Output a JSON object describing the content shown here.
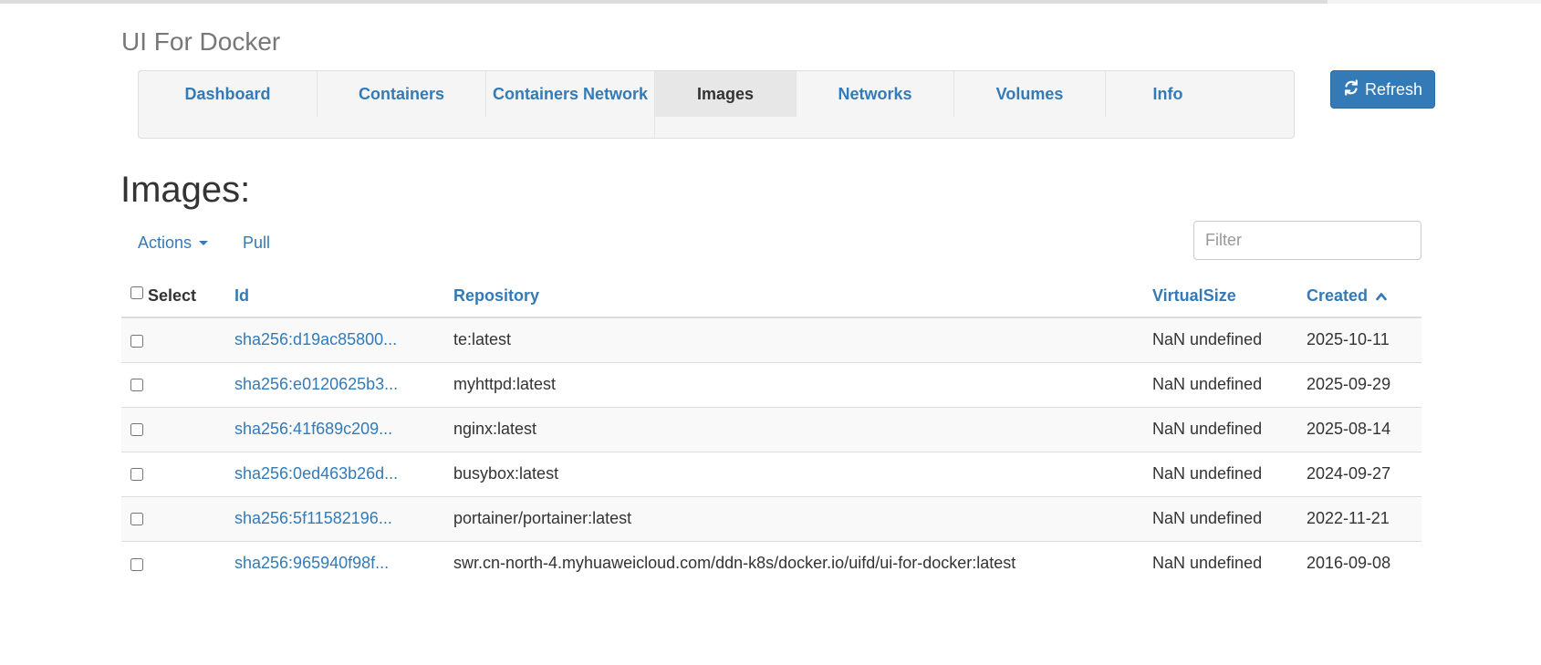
{
  "app_title": "UI For Docker",
  "nav": {
    "items": [
      {
        "label": "Dashboard"
      },
      {
        "label": "Containers"
      },
      {
        "label": "Containers Network"
      },
      {
        "label": "Images"
      },
      {
        "label": "Networks"
      },
      {
        "label": "Volumes"
      },
      {
        "label": "Info"
      }
    ],
    "active": "Images",
    "refresh_label": "Refresh"
  },
  "page": {
    "heading": "Images:",
    "actions_label": "Actions",
    "pull_label": "Pull",
    "filter_placeholder": "Filter",
    "filter_value": ""
  },
  "table": {
    "select_label": "Select",
    "columns": [
      "Id",
      "Repository",
      "VirtualSize",
      "Created"
    ],
    "sorted_by": "Created",
    "rows": [
      {
        "id": "sha256:d19ac85800...",
        "repository": "te:latest",
        "virtual_size": "NaN undefined",
        "created": "2025-10-11",
        "checked": false
      },
      {
        "id": "sha256:e0120625b3...",
        "repository": "myhttpd:latest",
        "virtual_size": "NaN undefined",
        "created": "2025-09-29",
        "checked": false
      },
      {
        "id": "sha256:41f689c209...",
        "repository": "nginx:latest",
        "virtual_size": "NaN undefined",
        "created": "2025-08-14",
        "checked": false
      },
      {
        "id": "sha256:0ed463b26d...",
        "repository": "busybox:latest",
        "virtual_size": "NaN undefined",
        "created": "2024-09-27",
        "checked": false
      },
      {
        "id": "sha256:5f11582196...",
        "repository": "portainer/portainer:latest",
        "virtual_size": "NaN undefined",
        "created": "2022-11-21",
        "checked": false
      },
      {
        "id": "sha256:965940f98f...",
        "repository": "swr.cn-north-4.myhuaweicloud.com/ddn-k8s/docker.io/uifd/ui-for-docker:latest",
        "virtual_size": "NaN undefined",
        "created": "2016-09-08",
        "checked": false
      }
    ]
  },
  "colors": {
    "link": "#337ab7",
    "primary_button": "#337ab7",
    "nav_background": "#f5f5f5",
    "nav_active": "#e7e7e7",
    "row_stripe": "#f9f9f9"
  },
  "icons": {
    "refresh": "refresh-icon",
    "actions_caret": "caret-down-icon",
    "sort": "chevron-up-icon"
  }
}
